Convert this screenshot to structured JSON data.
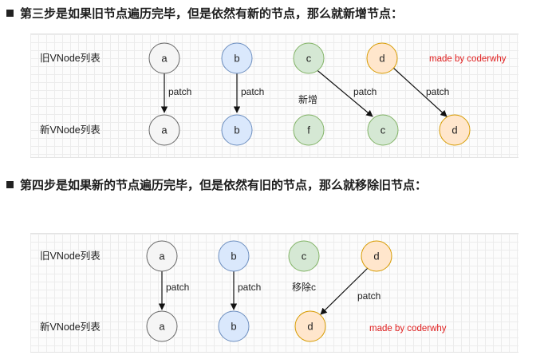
{
  "step3": {
    "title": "第三步是如果旧节点遍历完毕，但是依然有新的节点，那么就新增节点：",
    "old_label": "旧VNode列表",
    "new_label": "新VNode列表",
    "old_nodes": [
      "a",
      "b",
      "c",
      "d"
    ],
    "new_nodes": [
      "a",
      "b",
      "f",
      "c",
      "d"
    ],
    "edge_label": "patch",
    "add_label": "新增",
    "credit": "made by coderwhy"
  },
  "step4": {
    "title": "第四步是如果新的节点遍历完毕，但是依然有旧的节点，那么就移除旧节点：",
    "old_label": "旧VNode列表",
    "new_label": "新VNode列表",
    "old_nodes": [
      "a",
      "b",
      "c",
      "d"
    ],
    "new_nodes": [
      "a",
      "b",
      "d"
    ],
    "edge_label": "patch",
    "remove_label": "移除c",
    "credit": "made by coderwhy"
  },
  "colors": {
    "gray_fill": "#f5f5f5",
    "gray_stroke": "#666666",
    "blue_fill": "#dae8fc",
    "blue_stroke": "#6c8ebf",
    "green_fill": "#d5e8d4",
    "green_stroke": "#82b366",
    "orange_fill": "#ffe6cc",
    "orange_stroke": "#d79b00",
    "credit": "#e02020"
  }
}
